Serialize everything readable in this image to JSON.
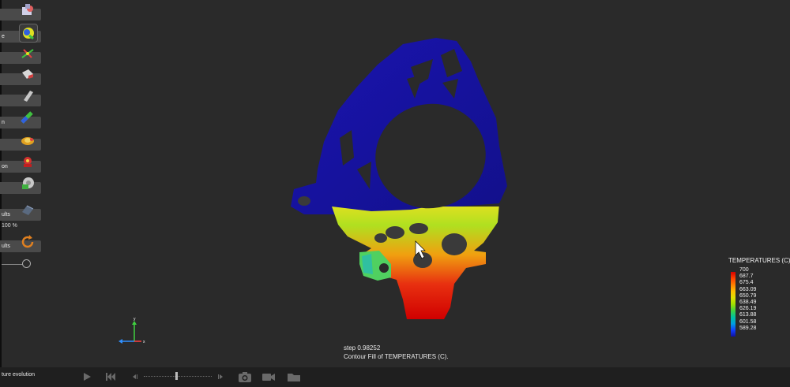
{
  "sidebar": {
    "rows": [
      {
        "label": "",
        "icon": "import-icon"
      },
      {
        "label": "e",
        "icon": "material-icon"
      },
      {
        "label": "",
        "icon": "stir-icon"
      },
      {
        "label": "",
        "icon": "block-icon"
      },
      {
        "label": "",
        "icon": "cylinder-icon"
      },
      {
        "label": "n",
        "icon": "pipe-icon"
      },
      {
        "label": "",
        "icon": "pour-icon"
      },
      {
        "label": "on",
        "icon": "gear-part-icon"
      },
      {
        "label": "",
        "icon": "settings-disc-icon"
      },
      {
        "label": "ults",
        "icon": "results-mesh-icon"
      },
      {
        "label": "ults",
        "icon": "refresh-icon"
      }
    ],
    "zoom_level": "100 %"
  },
  "viewport": {
    "step_text": "step 0.98252",
    "contour_text": "Contour Fill of TEMPERATURES (C)."
  },
  "legend": {
    "title": "TEMPERATURES (C)",
    "values": [
      "700",
      "687.7",
      "675.4",
      "663.09",
      "650.79",
      "638.49",
      "626.19",
      "613.88",
      "601.58",
      "589.28"
    ]
  },
  "bottom": {
    "label": "ture evolution",
    "controls": [
      "play-icon",
      "skip-back-icon",
      "step-back-icon",
      "step-forward-icon",
      "camera-icon",
      "video-icon",
      "folder-icon"
    ]
  },
  "colors": {
    "background": "#2a2a2a",
    "cold": "#1a12a0",
    "hot": "#d40000"
  }
}
